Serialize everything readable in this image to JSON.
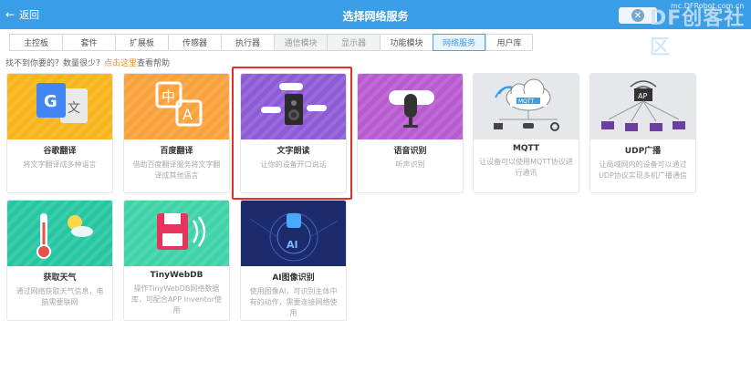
{
  "header": {
    "back_label": "返回",
    "title": "选择网络服务",
    "watermark": "DF创客社区",
    "watermark_small": "mc.DFRobot.com.cn"
  },
  "tabs": [
    {
      "label": "主控板",
      "state": "normal"
    },
    {
      "label": "套件",
      "state": "normal"
    },
    {
      "label": "扩展板",
      "state": "normal"
    },
    {
      "label": "传感器",
      "state": "normal"
    },
    {
      "label": "执行器",
      "state": "normal"
    },
    {
      "label": "通信模块",
      "state": "dim"
    },
    {
      "label": "显示器",
      "state": "dim"
    },
    {
      "label": "功能模块",
      "state": "normal"
    },
    {
      "label": "网络服务",
      "state": "active"
    },
    {
      "label": "用户库",
      "state": "normal"
    }
  ],
  "hint": {
    "prefix": "找不到你要的？数量很少？",
    "link": "点击这里",
    "suffix": "查看帮助"
  },
  "cards": [
    {
      "name": "谷歌翻译",
      "desc": "将文字翻译成多种语言",
      "icon": "google-translate-icon",
      "color": "#f7b51b"
    },
    {
      "name": "百度翻译",
      "desc": "借助百度翻译服务将文字翻译成其他语言",
      "icon": "translate-icon",
      "color": "#f9a13b"
    },
    {
      "name": "文字朗读",
      "desc": "让你的设备开口说话",
      "icon": "speaker-icon",
      "color": "#8e5bd6"
    },
    {
      "name": "语音识别",
      "desc": "听声识别",
      "icon": "microphone-icon",
      "color": "#b85bd1"
    },
    {
      "name": "MQTT",
      "desc": "让设备可以使用MQTT协议进行通讯",
      "icon": "mqtt-cloud-icon",
      "color": "#e5e7ea"
    },
    {
      "name": "UDP广播",
      "desc": "让局域网内的设备可以通过UDP协议实现多机广播通信",
      "icon": "udp-network-icon",
      "color": "#e5e7ea"
    },
    {
      "name": "获取天气",
      "desc": "通过网络获取天气信息，电脑需要联网",
      "icon": "weather-icon",
      "color": "#27c6a3"
    },
    {
      "name": "TinyWebDB",
      "desc": "操作TinyWebDB网络数据库，可配合APP Inventor使用",
      "icon": "database-icon",
      "color": "#3fd3a8"
    },
    {
      "name": "AI图像识别",
      "desc": "使用图像AI，可识别主体中有的动作，需要连接网络使用",
      "icon": "ai-vision-icon",
      "color": "#1c2b6b"
    }
  ]
}
